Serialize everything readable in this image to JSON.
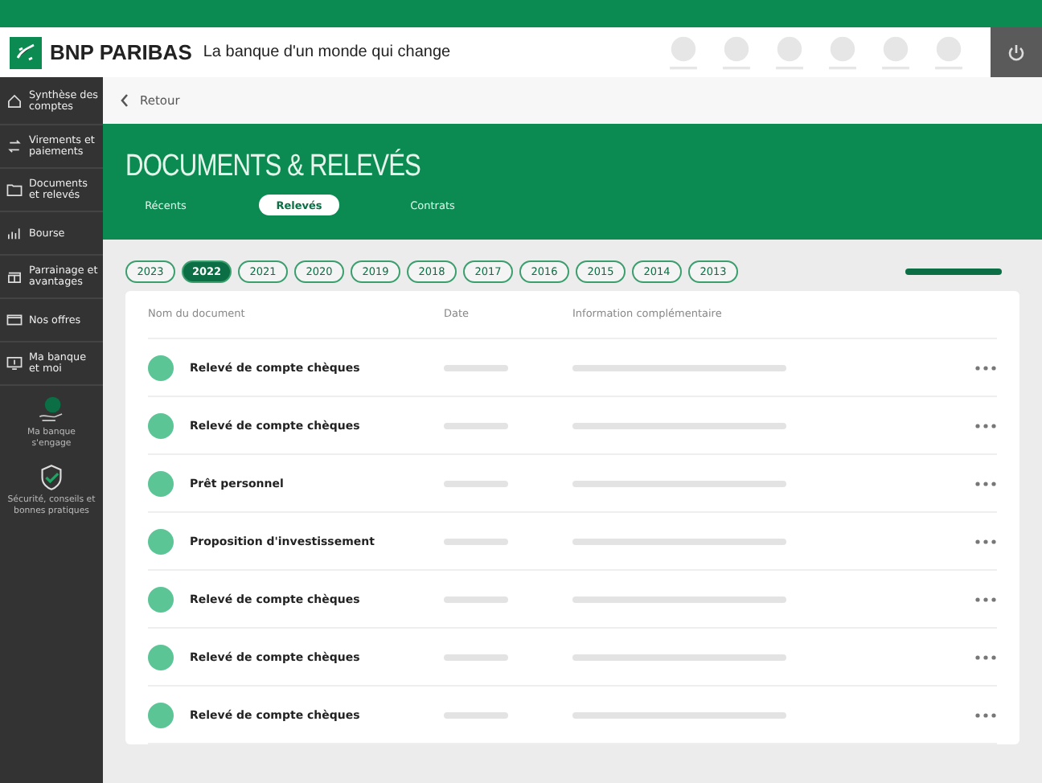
{
  "header": {
    "brand": "BNP PARIBAS",
    "tagline": "La banque d'un monde qui change"
  },
  "sidebar": {
    "items": [
      {
        "label": "Synthèse des comptes"
      },
      {
        "label": "Virements et paiements"
      },
      {
        "label": "Documents et relevés"
      },
      {
        "label": "Bourse"
      },
      {
        "label": "Parrainage et avantages"
      },
      {
        "label": "Nos offres"
      },
      {
        "label": "Ma banque et moi"
      }
    ],
    "extras": [
      {
        "label": "Ma banque s'engage"
      },
      {
        "label": "Sécurité, conseils et bonnes pratiques"
      }
    ]
  },
  "back_link": "Retour",
  "page_title": "DOCUMENTS & RELEVÉS",
  "tabs": [
    {
      "label": "Récents",
      "selected": false
    },
    {
      "label": "Relevés",
      "selected": true
    },
    {
      "label": "Contrats",
      "selected": false
    }
  ],
  "years": [
    {
      "label": "2023",
      "selected": false
    },
    {
      "label": "2022",
      "selected": true
    },
    {
      "label": "2021",
      "selected": false
    },
    {
      "label": "2020",
      "selected": false
    },
    {
      "label": "2019",
      "selected": false
    },
    {
      "label": "2018",
      "selected": false
    },
    {
      "label": "2017",
      "selected": false
    },
    {
      "label": "2016",
      "selected": false
    },
    {
      "label": "2015",
      "selected": false
    },
    {
      "label": "2014",
      "selected": false
    },
    {
      "label": "2013",
      "selected": false
    }
  ],
  "table": {
    "columns": [
      "Nom du document",
      "Date",
      "Information complémentaire"
    ],
    "rows": [
      {
        "name": "Relevé de compte chèques"
      },
      {
        "name": "Relevé de compte chèques"
      },
      {
        "name": "Prêt personnel"
      },
      {
        "name": "Proposition d'investissement"
      },
      {
        "name": "Relevé de compte chèques"
      },
      {
        "name": "Relevé de compte chèques"
      },
      {
        "name": "Relevé de compte chèques"
      }
    ]
  }
}
